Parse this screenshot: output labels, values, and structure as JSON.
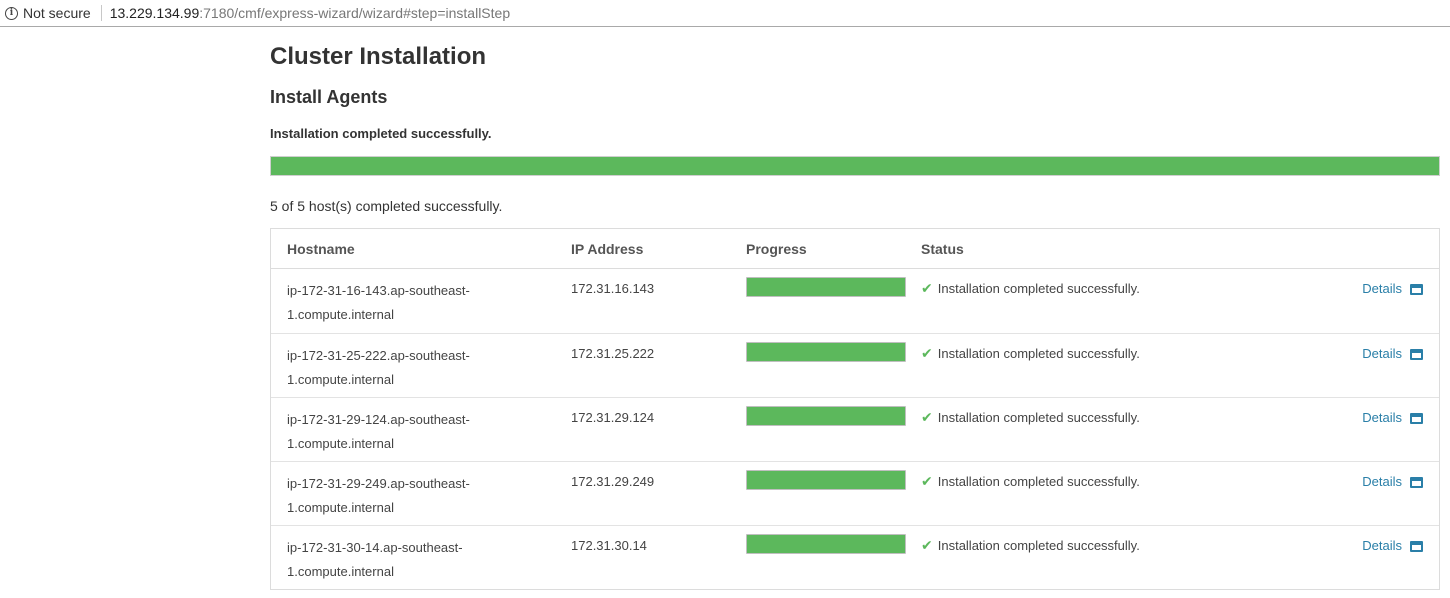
{
  "browser": {
    "security_label": "Not secure",
    "url_host": "13.229.134.99",
    "url_rest": ":7180/cmf/express-wizard/wizard#step=installStep"
  },
  "page": {
    "title": "Cluster Installation",
    "subtitle": "Install Agents",
    "status_message": "Installation completed successfully.",
    "overall_progress_percent": 100,
    "hosts_summary": "5 of 5 host(s) completed successfully."
  },
  "colors": {
    "progress": "#5cb85c",
    "link": "#2a7fa8"
  },
  "table": {
    "headers": {
      "hostname": "Hostname",
      "ip": "IP Address",
      "progress": "Progress",
      "status": "Status"
    },
    "rows": [
      {
        "hostname_line1": "ip-172-31-16-143.ap-southeast-",
        "hostname_line2": "1.compute.internal",
        "ip": "172.31.16.143",
        "progress_percent": 100,
        "status": "Installation completed successfully.",
        "details": "Details"
      },
      {
        "hostname_line1": "ip-172-31-25-222.ap-southeast-",
        "hostname_line2": "1.compute.internal",
        "ip": "172.31.25.222",
        "progress_percent": 100,
        "status": "Installation completed successfully.",
        "details": "Details"
      },
      {
        "hostname_line1": "ip-172-31-29-124.ap-southeast-",
        "hostname_line2": "1.compute.internal",
        "ip": "172.31.29.124",
        "progress_percent": 100,
        "status": "Installation completed successfully.",
        "details": "Details"
      },
      {
        "hostname_line1": "ip-172-31-29-249.ap-southeast-",
        "hostname_line2": "1.compute.internal",
        "ip": "172.31.29.249",
        "progress_percent": 100,
        "status": "Installation completed successfully.",
        "details": "Details"
      },
      {
        "hostname_line1": "ip-172-31-30-14.ap-southeast-",
        "hostname_line2": "1.compute.internal",
        "ip": "172.31.30.14",
        "progress_percent": 100,
        "status": "Installation completed successfully.",
        "details": "Details"
      }
    ]
  },
  "icons": {
    "security": "info-circle-icon",
    "status_ok": "check-icon",
    "details": "window-icon"
  }
}
